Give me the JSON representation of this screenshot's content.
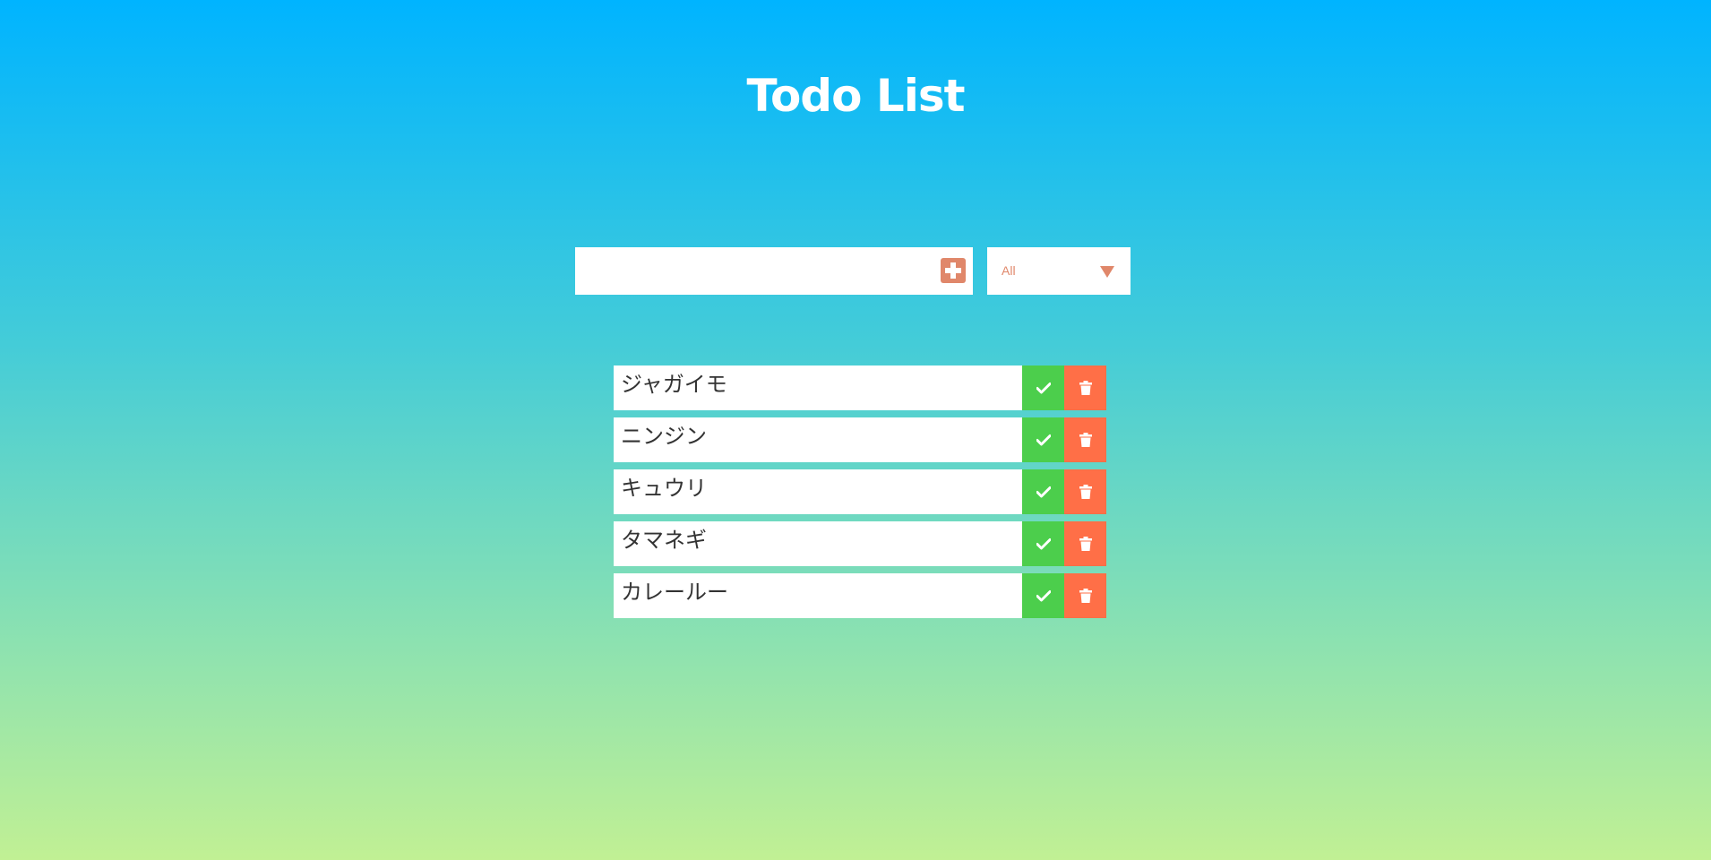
{
  "header": {
    "title": "Todo List"
  },
  "input": {
    "value": "",
    "placeholder": "",
    "add_icon": "plus-square-icon"
  },
  "filter": {
    "selected": "All",
    "caret_icon": "triangle-down-icon"
  },
  "todos": [
    {
      "text": "ジャガイモ",
      "complete_icon": "check-icon",
      "delete_icon": "trash-icon"
    },
    {
      "text": "ニンジン",
      "complete_icon": "check-icon",
      "delete_icon": "trash-icon"
    },
    {
      "text": "キュウリ",
      "complete_icon": "check-icon",
      "delete_icon": "trash-icon"
    },
    {
      "text": "タマネギ",
      "complete_icon": "check-icon",
      "delete_icon": "trash-icon"
    },
    {
      "text": "カレールー",
      "complete_icon": "check-icon",
      "delete_icon": "trash-icon"
    }
  ],
  "colors": {
    "accent": "#e0876a",
    "complete": "#4cce4c",
    "delete": "#ff6f47",
    "gradient_top": "#00b4ff",
    "gradient_bottom": "#c1f094"
  }
}
